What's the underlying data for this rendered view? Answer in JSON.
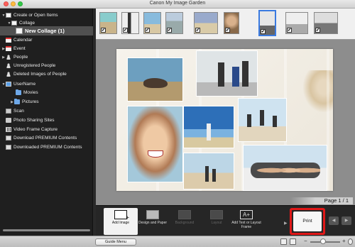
{
  "window": {
    "title": "Canon My Image Garden"
  },
  "sidebar": {
    "items": [
      {
        "label": "Create or Open Items",
        "arrow": "▼",
        "icon": "doc-icon"
      },
      {
        "label": "Collage",
        "arrow": "▼",
        "icon": "collage-icon"
      },
      {
        "label": "New Collage (1)",
        "arrow": "",
        "icon": "collage-item-icon",
        "selected": true
      },
      {
        "label": "Calendar",
        "arrow": "",
        "icon": "calendar-icon"
      },
      {
        "label": "Event",
        "arrow": "▶",
        "icon": "event-icon"
      },
      {
        "label": "People",
        "arrow": "▶",
        "icon": "people-icon"
      },
      {
        "label": "Unregistered People",
        "arrow": "",
        "icon": "unregistered-people-icon"
      },
      {
        "label": "Deleted Images of People",
        "arrow": "",
        "icon": "deleted-people-icon"
      },
      {
        "label": "UserName",
        "arrow": "▼",
        "icon": "computer-icon"
      },
      {
        "label": "Movies",
        "arrow": "",
        "icon": "folder-icon"
      },
      {
        "label": "Pictures",
        "arrow": "▶",
        "icon": "folder-icon"
      },
      {
        "label": "Scan",
        "arrow": "",
        "icon": "scan-icon"
      },
      {
        "label": "Photo Sharing Sites",
        "arrow": "",
        "icon": "share-icon"
      },
      {
        "label": "Video Frame Capture",
        "arrow": "",
        "icon": "film-icon"
      },
      {
        "label": "Download PREMIUM Contents",
        "arrow": "",
        "icon": "download-icon"
      },
      {
        "label": "Downloaded PREMIUM Contents",
        "arrow": "",
        "icon": "downloaded-icon"
      }
    ]
  },
  "thumbnails": [
    {
      "checked": "✔",
      "selected": false
    },
    {
      "checked": "✔",
      "selected": false
    },
    {
      "checked": "✔",
      "selected": false
    },
    {
      "checked": "✔",
      "selected": false
    },
    {
      "checked": "✔",
      "selected": false
    },
    {
      "checked": "✔",
      "selected": false
    },
    {
      "checked": "✔",
      "selected": true
    },
    {
      "checked": "✔",
      "selected": false
    },
    {
      "checked": "✔",
      "selected": false
    }
  ],
  "canvas": {
    "page_indicator": "Page 1 / 1"
  },
  "toolbar": {
    "buttons": [
      {
        "label": "Add Image",
        "enabled": true
      },
      {
        "label": "Design and Paper",
        "enabled": true
      },
      {
        "label": "Background",
        "enabled": false
      },
      {
        "label": "Layout",
        "enabled": false
      },
      {
        "label": "Add Text or Layout Frame",
        "enabled": true
      }
    ],
    "print_label": "Print",
    "prev_symbol": "◀",
    "next_symbol": "▶"
  },
  "statusbar": {
    "guide_menu_label": "Guide Menu",
    "zoom_minus": "−",
    "zoom_plus": "+"
  },
  "colors": {
    "accent": "#3a7ae0",
    "highlight_border": "#e01818"
  }
}
